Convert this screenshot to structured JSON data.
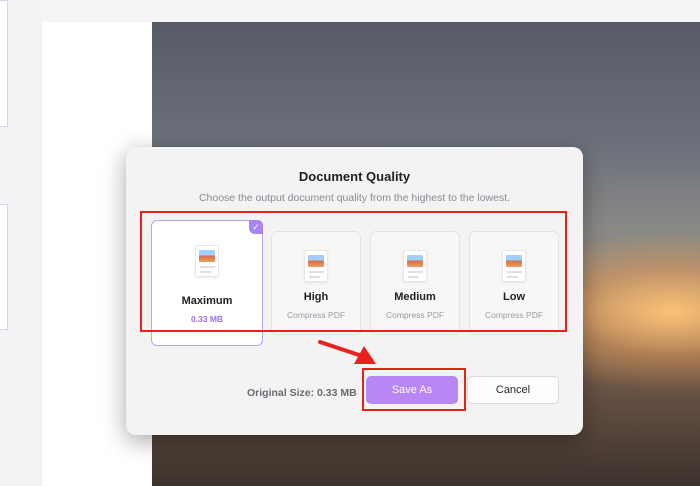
{
  "dialog": {
    "title": "Document Quality",
    "subtitle": "Choose the output document quality from the highest to the lowest.",
    "options": [
      {
        "name": "Maximum",
        "meta": "0.33 MB",
        "selected": true
      },
      {
        "name": "High",
        "meta": "Compress PDF",
        "selected": false
      },
      {
        "name": "Medium",
        "meta": "Compress PDF",
        "selected": false
      },
      {
        "name": "Low",
        "meta": "Compress PDF",
        "selected": false
      }
    ],
    "original_size": "Original Size: 0.33 MB",
    "save_label": "Save As",
    "cancel_label": "Cancel",
    "check_icon": "check-icon",
    "option_icon": "pdf-image-doc-icon"
  },
  "colors": {
    "accent": "#b887f5",
    "selected_border": "#b9a3f3",
    "annotation": "#e8211d"
  }
}
